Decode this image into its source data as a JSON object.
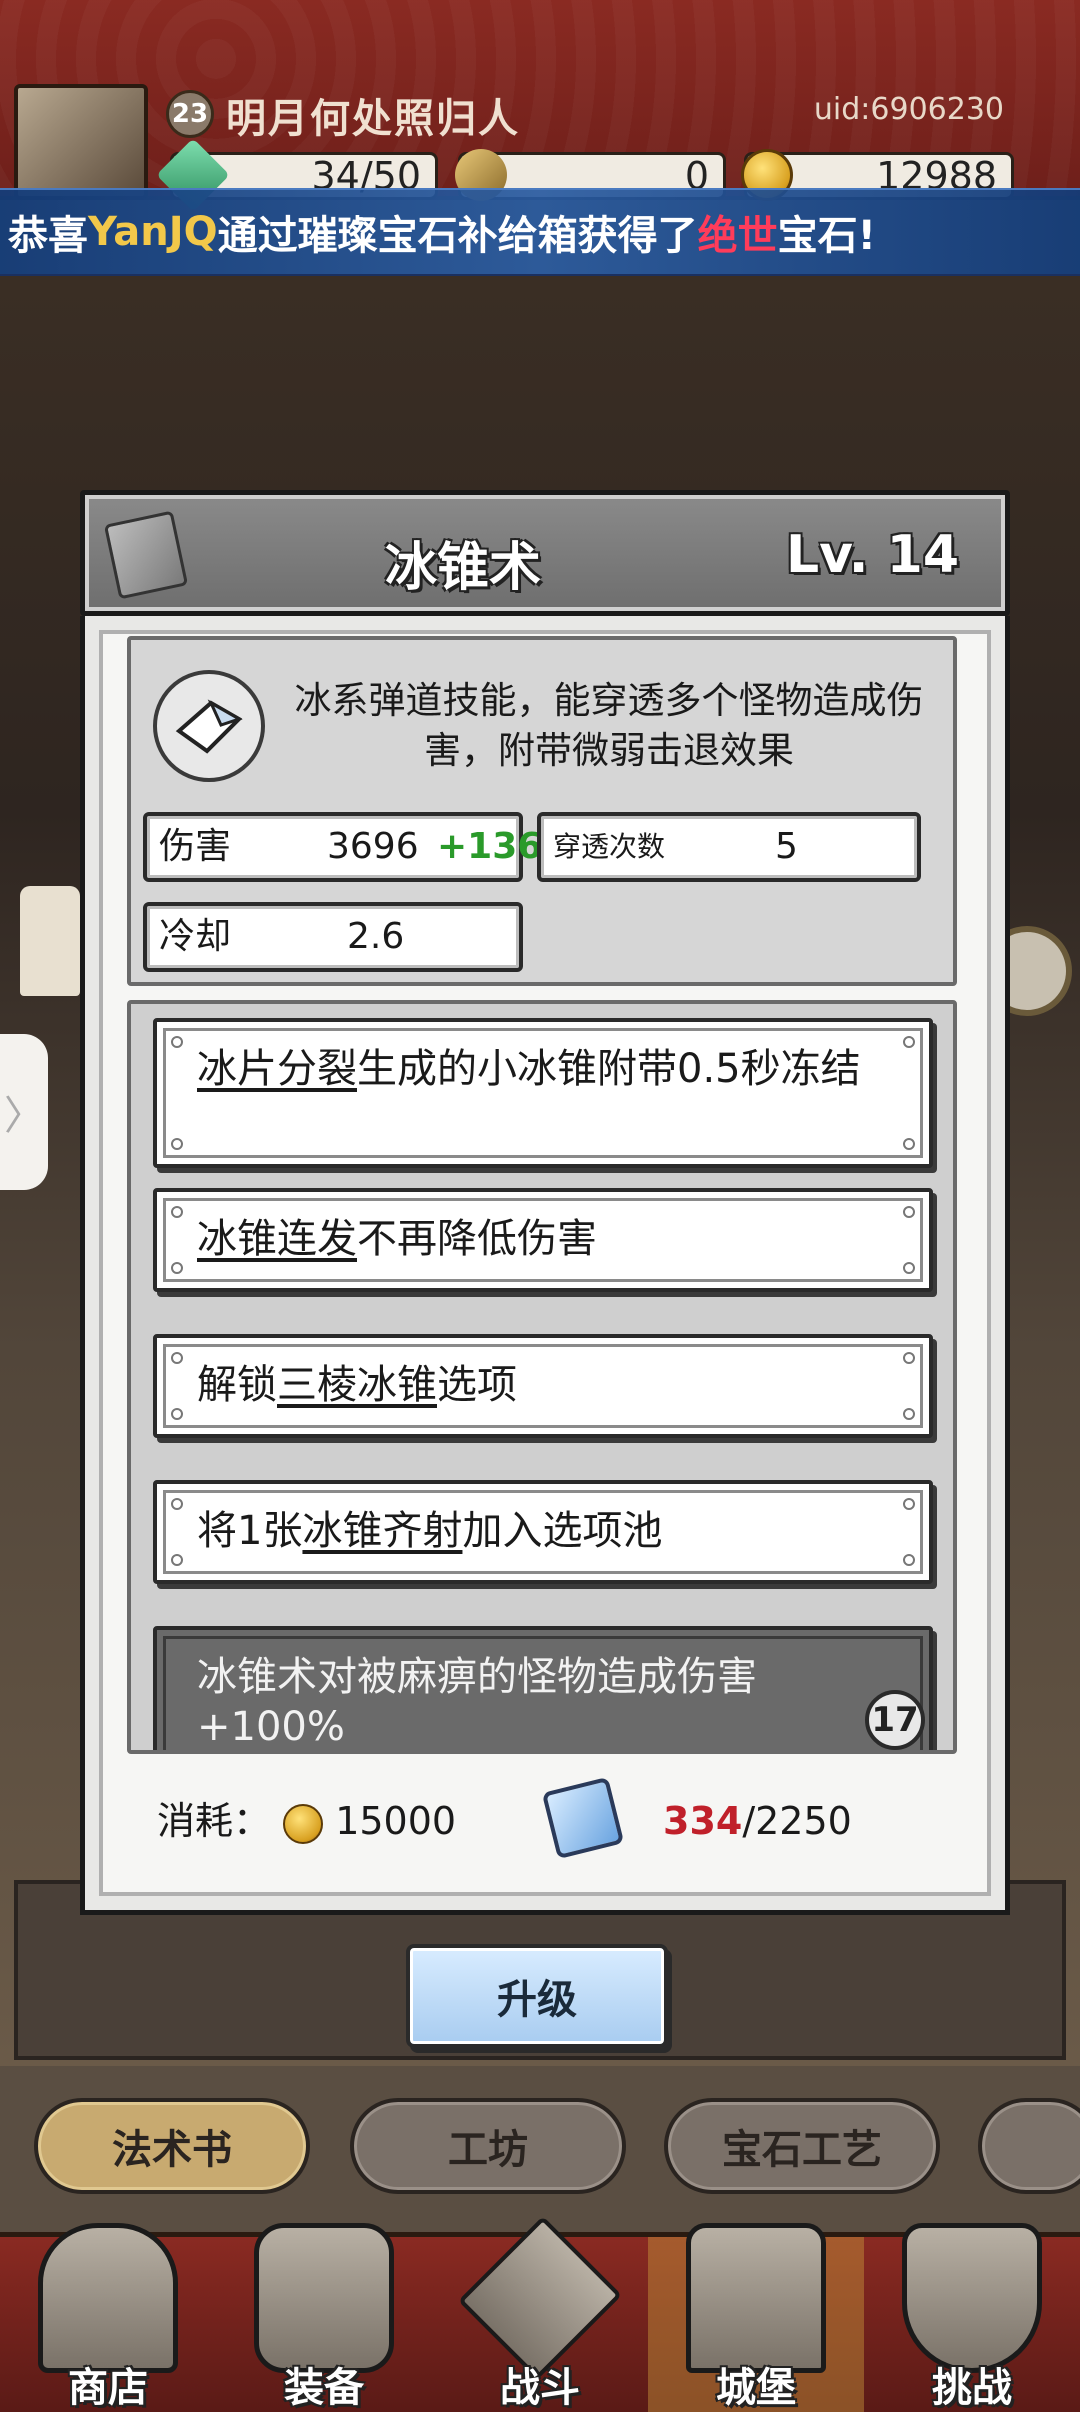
{
  "header": {
    "level": "23",
    "player_name": "明月何处照归人",
    "uid": "uid:6906230",
    "resources": [
      {
        "value": "34/50",
        "icon": "energy-gem-icon"
      },
      {
        "value": "0",
        "icon": "key-icon"
      },
      {
        "value": "12988",
        "icon": "gold-coin-icon"
      }
    ]
  },
  "banner": {
    "prefix": "恭喜",
    "player": "YanJQ",
    "middle": "通过璀璨宝石补给箱获得了",
    "grade": "绝世",
    "suffix": "宝石!",
    "colors": {
      "player": "#f2c84a",
      "grade": "#ff3c5a"
    }
  },
  "skill": {
    "name": "冰锥术",
    "level": "Lv. 14",
    "description": "冰系弹道技能，能穿透多个怪物造成伤害，附带微弱击退效果",
    "stats": {
      "damage_label": "伤害",
      "damage_value": "3696",
      "damage_bonus": "+136",
      "pierce_label": "穿透次数",
      "pierce_value": "5",
      "cooldown_label": "冷却",
      "cooldown_value": "2.6"
    },
    "upgrades": [
      {
        "link": "冰片分裂",
        "text": "生成的小冰锥附带0.5秒冻结"
      },
      {
        "link": "冰锥连发",
        "text": "不再降低伤害"
      },
      {
        "pre": "解锁",
        "link": "三棱冰锥",
        "text": "选项"
      },
      {
        "pre": "将1张",
        "link": "冰锥齐射",
        "text": "加入选项池"
      },
      {
        "text": "冰锥术对被麻痹的怪物造成伤害+100%",
        "unlock_level": "17"
      }
    ],
    "cost": {
      "label": "消耗：",
      "gold": "15000",
      "shards_current": "334",
      "shards_required": "/2250"
    }
  },
  "upgrade_button": "升级",
  "tabs": [
    "法术书",
    "工坊",
    "宝石工艺"
  ],
  "nav": [
    {
      "label": "商店",
      "icon": "shop-icon"
    },
    {
      "label": "装备",
      "icon": "backpack-icon"
    },
    {
      "label": "战斗",
      "icon": "crossed-swords-icon"
    },
    {
      "label": "城堡",
      "icon": "castle-icon"
    },
    {
      "label": "挑战",
      "icon": "shield-icon"
    }
  ],
  "side_handle": "〉"
}
